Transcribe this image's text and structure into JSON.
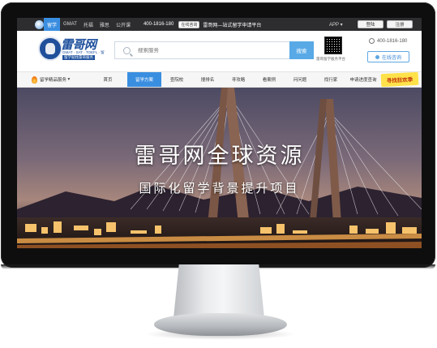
{
  "topbar": {
    "tabs": [
      "留学",
      "GMAT",
      "托福",
      "雅思",
      "公开课"
    ],
    "phone": "400-1816-180",
    "consult_label": "在线咨询",
    "slogan": "雷哥网—站式留学申请平台",
    "app_label": "APP",
    "login_label": "登陆",
    "register_label": "注册"
  },
  "header": {
    "logo_text": "雷哥网",
    "logo_sub1": "GMAT · SAT · TOEFL · 留学",
    "logo_sub2": "留学就找雷哥服务",
    "search_placeholder": "搜索服务",
    "search_button": "搜索",
    "qr_caption": "雷哥留学服务平台",
    "hotline": "400-1816-180",
    "online_label": "在线咨询"
  },
  "nav": {
    "service_label": "留学精品服务",
    "items": [
      "首页",
      "留学方案",
      "查院校",
      "搜排名",
      "寻攻略",
      "看案例",
      "问问题",
      "找行家",
      "申请进度查询"
    ],
    "active_index": 1,
    "promo": "寻找狂欢季"
  },
  "banner": {
    "title": "雷哥网全球资源",
    "subtitle": "国际化留学背景提升项目"
  },
  "colors": {
    "accent": "#3a8ee0",
    "topbar_bg": "#2d2d30",
    "brand": "#1d4f9c",
    "promo_bg": "#ffe24a"
  }
}
